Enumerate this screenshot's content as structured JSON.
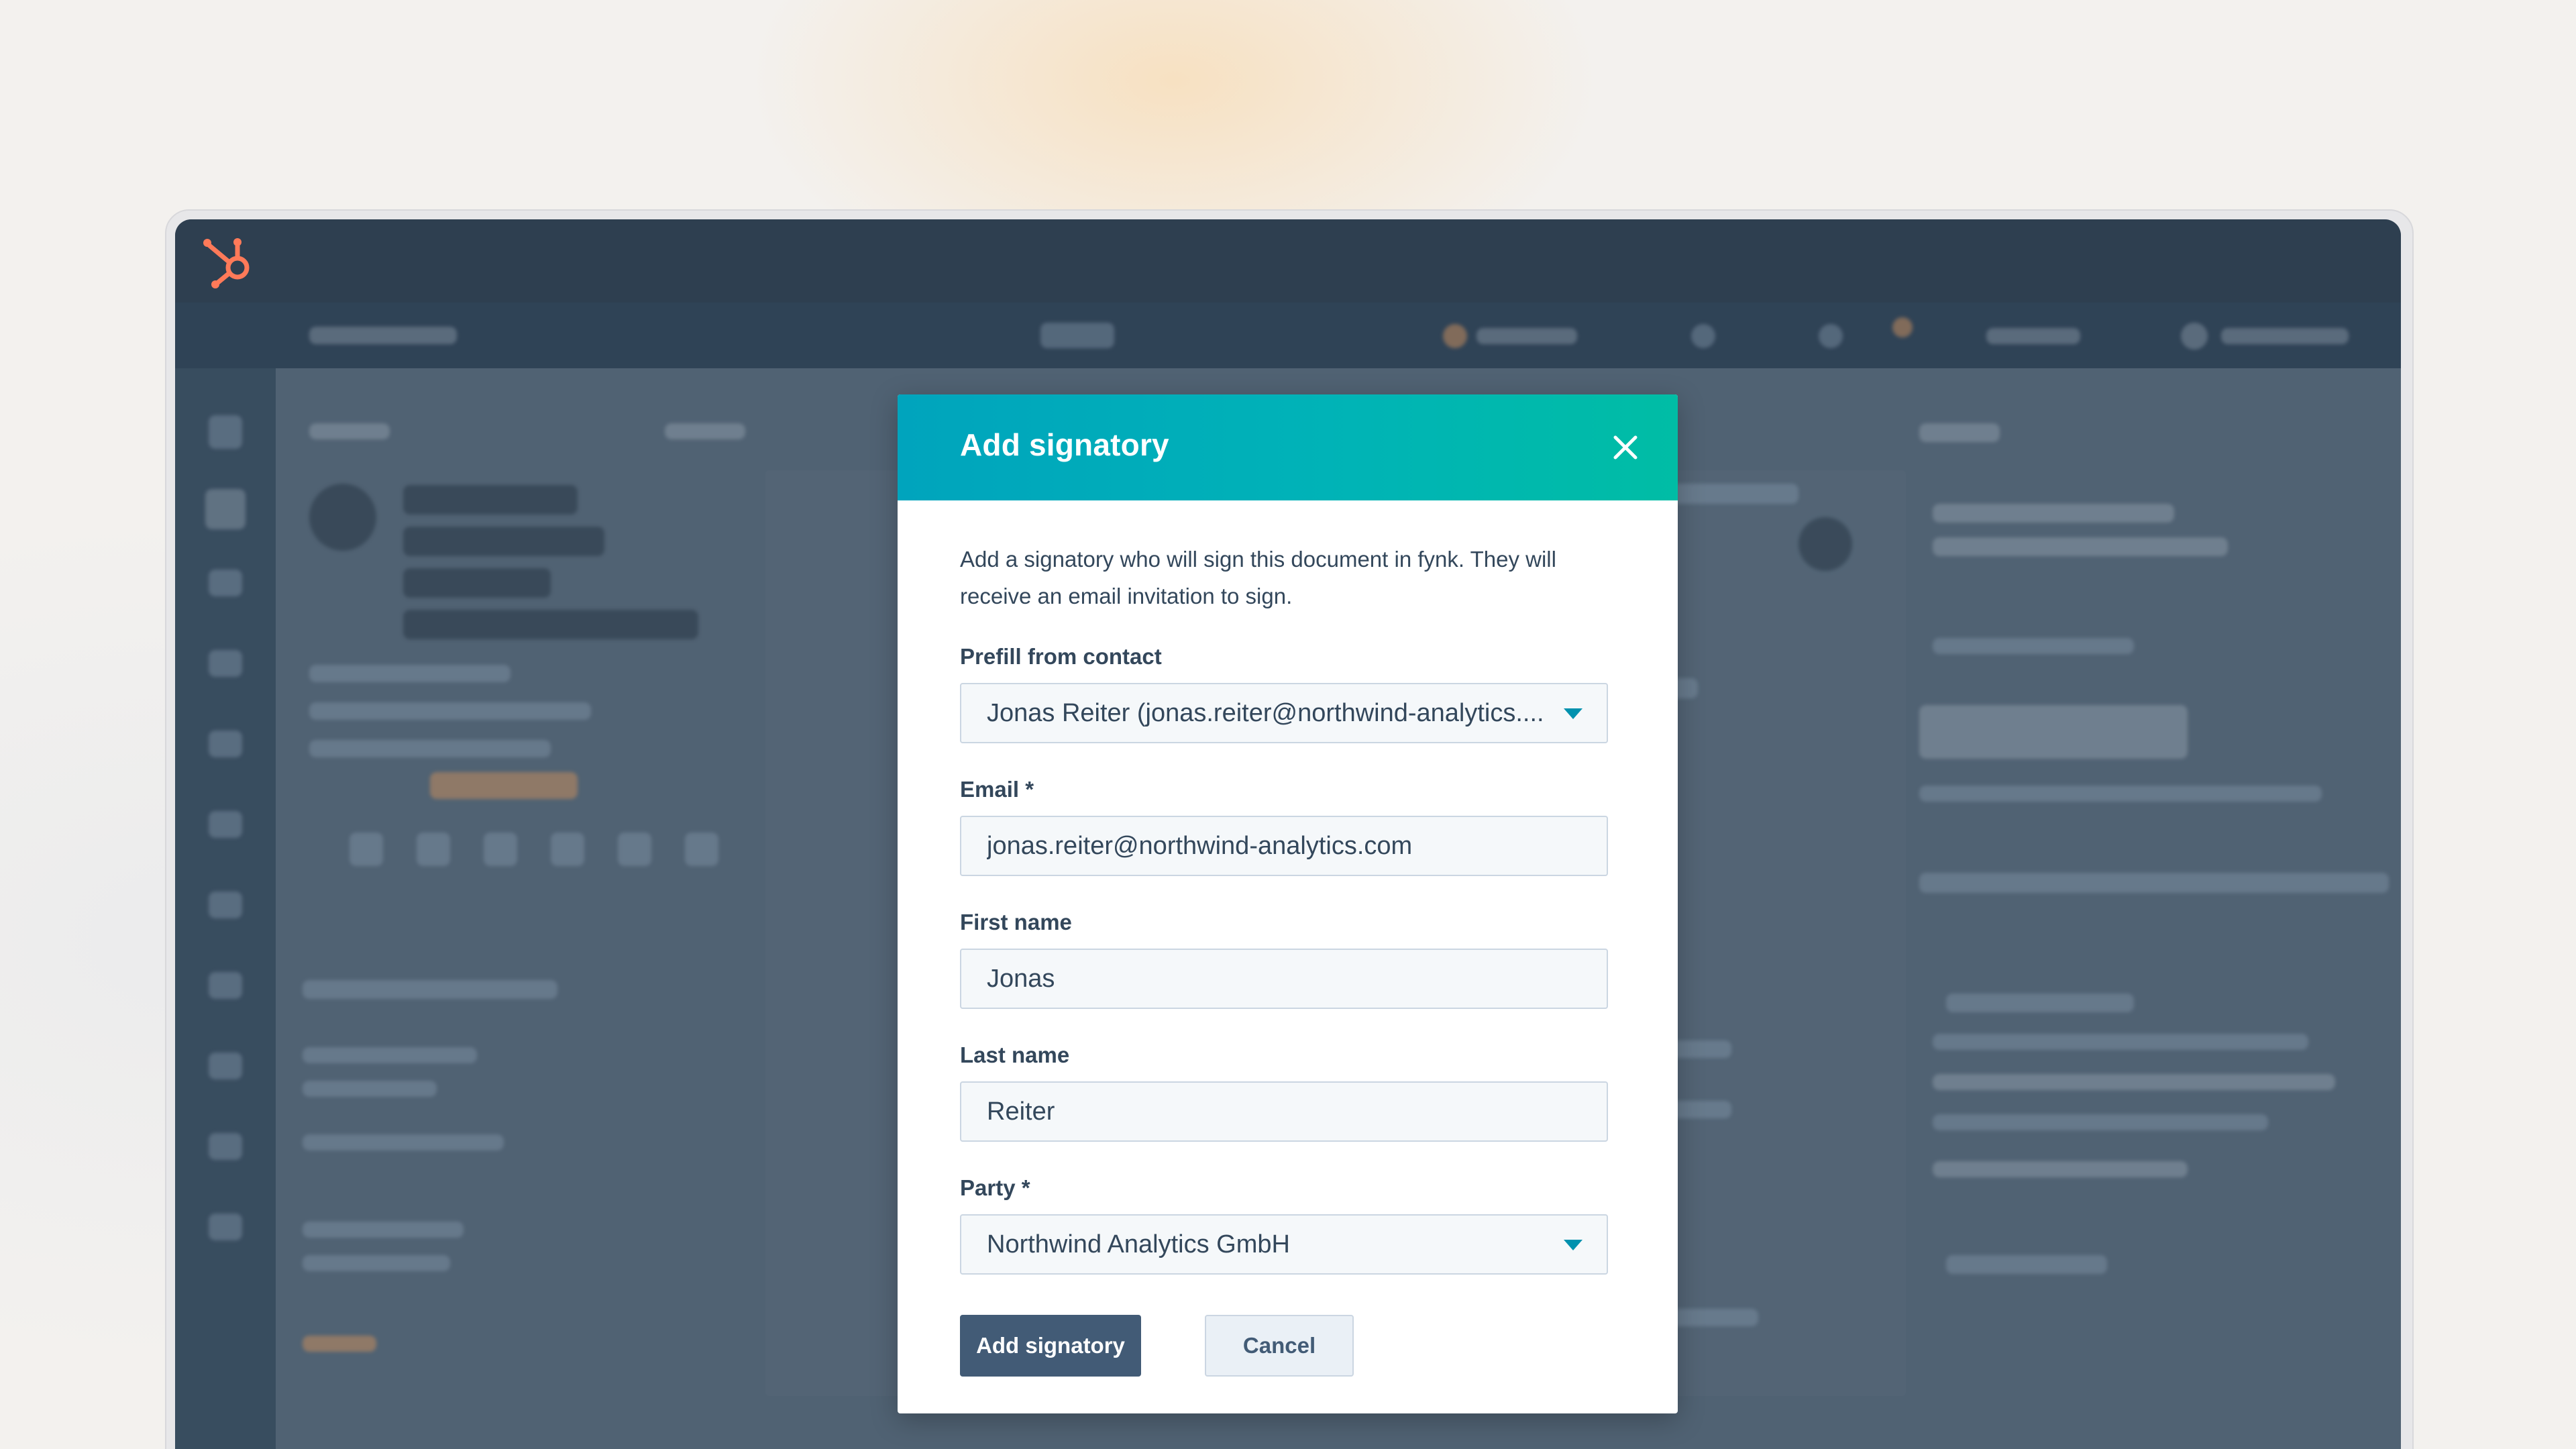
{
  "brand": {
    "logo_icon": "hubspot-sprocket-icon",
    "logo_color": "#ff7a59"
  },
  "modal": {
    "title": "Add signatory",
    "close_icon": "close-icon",
    "description": "Add a signatory who will sign this document in fynk. They will receive an email invitation to sign.",
    "header_gradient": [
      "#00a4bd",
      "#00bda5"
    ],
    "fields": {
      "prefill": {
        "label": "Prefill from contact",
        "value": "Jonas Reiter (jonas.reiter@northwind-analytics...."
      },
      "email": {
        "label": "Email *",
        "value": "jonas.reiter@northwind-analytics.com"
      },
      "first_name": {
        "label": "First name",
        "value": "Jonas"
      },
      "last_name": {
        "label": "Last name",
        "value": "Reiter"
      },
      "party": {
        "label": "Party *",
        "value": "Northwind Analytics GmbH"
      }
    },
    "buttons": {
      "primary": "Add signatory",
      "secondary": "Cancel"
    }
  }
}
